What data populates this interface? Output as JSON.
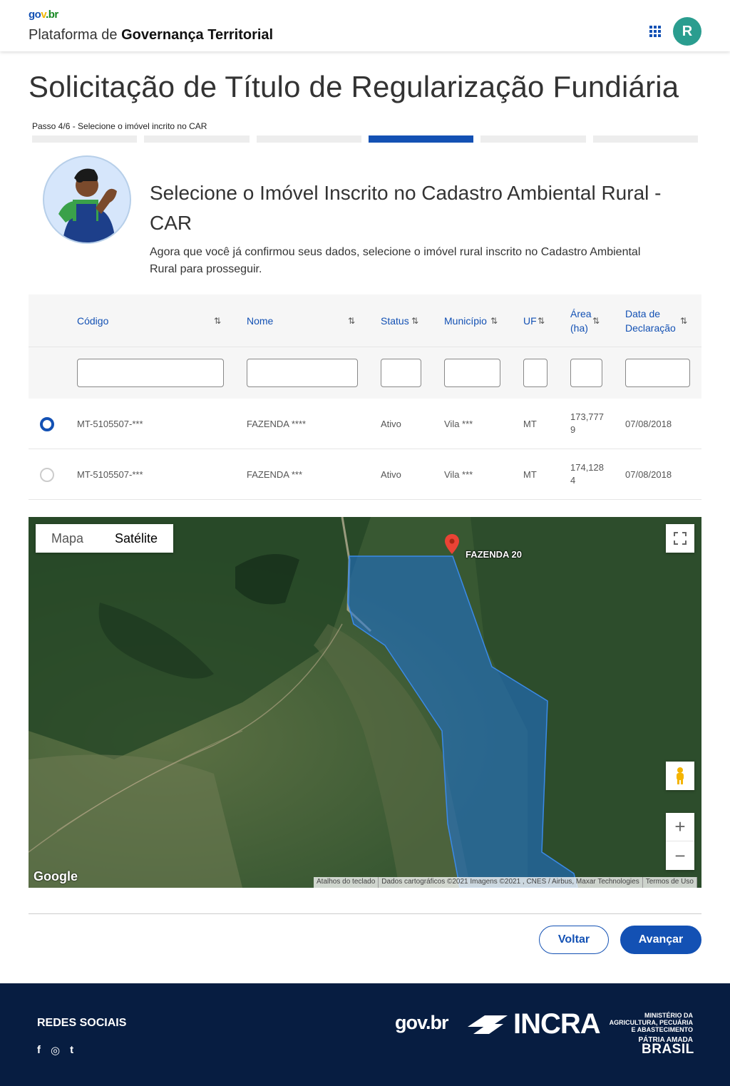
{
  "header": {
    "logo": {
      "p1": "go",
      "p2": "v",
      "p3": ".br"
    },
    "platform_prefix": "Plataforma de ",
    "platform_name": "Governança Territorial",
    "avatar_initial": "R"
  },
  "page": {
    "title": "Solicitação de Título de Regularização Fundiária",
    "step_label": "Passo 4/6 - Selecione o imóvel incrito no CAR",
    "steps_total": 6,
    "steps_active": 4
  },
  "intro": {
    "title": "Selecione o Imóvel Inscrito no Cadastro Ambiental Rural - CAR",
    "text": "Agora que você já confirmou seus dados, selecione o imóvel rural inscrito no Cadastro Ambiental Rural para prosseguir."
  },
  "table": {
    "columns": [
      "Código",
      "Nome",
      "Status",
      "Município",
      "UF",
      "Área (ha)",
      "Data de Declaração"
    ],
    "sort_icon": "⇅",
    "rows": [
      {
        "selected": true,
        "codigo": "MT-5105507-***",
        "nome": "FAZENDA ****",
        "status": "Ativo",
        "municipio": "Vila ***",
        "uf": "MT",
        "area": "173,7779",
        "data": "07/08/2018"
      },
      {
        "selected": false,
        "codigo": "MT-5105507-***",
        "nome": "FAZENDA ***",
        "status": "Ativo",
        "municipio": "Vila ***",
        "uf": "MT",
        "area": "174,1284",
        "data": "07/08/2018"
      }
    ]
  },
  "map": {
    "type_map": "Mapa",
    "type_satellite": "Satélite",
    "marker_label": "FAZENDA 20",
    "google": "Google",
    "footer": [
      "Atalhos do teclado",
      "Dados cartográficos ©2021 Imagens ©2021 , CNES / Airbus, Maxar Technologies",
      "Termos de Uso"
    ],
    "zoom_in": "+",
    "zoom_out": "−"
  },
  "actions": {
    "back": "Voltar",
    "next": "Avançar"
  },
  "footer": {
    "social_title": "REDES SOCIAIS",
    "social_icons": [
      "f",
      "◎",
      "t"
    ],
    "govbr": "gov.br",
    "incra": "INCRA",
    "ministry": "MINISTÉRIO DA AGRICULTURA, PECUÁRIA E ABASTECIMENTO",
    "patria": "PÁTRIA AMADA",
    "brasil": "BRASIL"
  }
}
